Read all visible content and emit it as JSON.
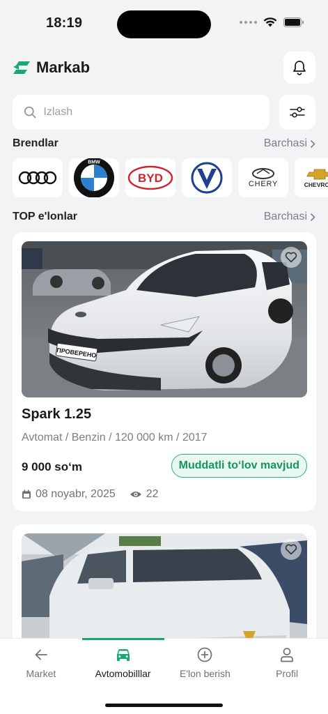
{
  "status_bar": {
    "time": "18:19"
  },
  "header": {
    "app_name": "Markab"
  },
  "search": {
    "placeholder": "Izlash"
  },
  "brands_section": {
    "title": "Brendlar",
    "see_all": "Barchasi",
    "brands": [
      {
        "name": "Audi"
      },
      {
        "name": "BMW"
      },
      {
        "name": "BYD",
        "logo_text": "BYD"
      },
      {
        "name": "Changan"
      },
      {
        "name": "Chery",
        "logo_text": "CHERY"
      },
      {
        "name": "Chevrolet",
        "logo_text": "CHEVROLET"
      }
    ]
  },
  "top_section": {
    "title": "TOP e'lonlar",
    "see_all": "Barchasi"
  },
  "listings": [
    {
      "title": "Spark 1.25",
      "specs": "Avtomat / Benzin / 120 000 km / 2017",
      "price": "9 000 so‘m",
      "badge": "Muddatli to‘lov mavjud",
      "date": "08 noyabr, 2025",
      "views": "22",
      "plate_text": "ПРОВЕРЕНО"
    },
    {
      "title": ""
    }
  ],
  "bottom_nav": {
    "items": [
      {
        "label": "Market",
        "icon": "arrow-left-icon"
      },
      {
        "label": "Avtomobilllar",
        "icon": "car-icon",
        "active": true
      },
      {
        "label": "E'lon berish",
        "icon": "plus-circle-icon"
      },
      {
        "label": "Profil",
        "icon": "user-icon"
      }
    ]
  },
  "colors": {
    "accent": "#19a870",
    "background": "#f2f3f5",
    "card": "#ffffff"
  }
}
